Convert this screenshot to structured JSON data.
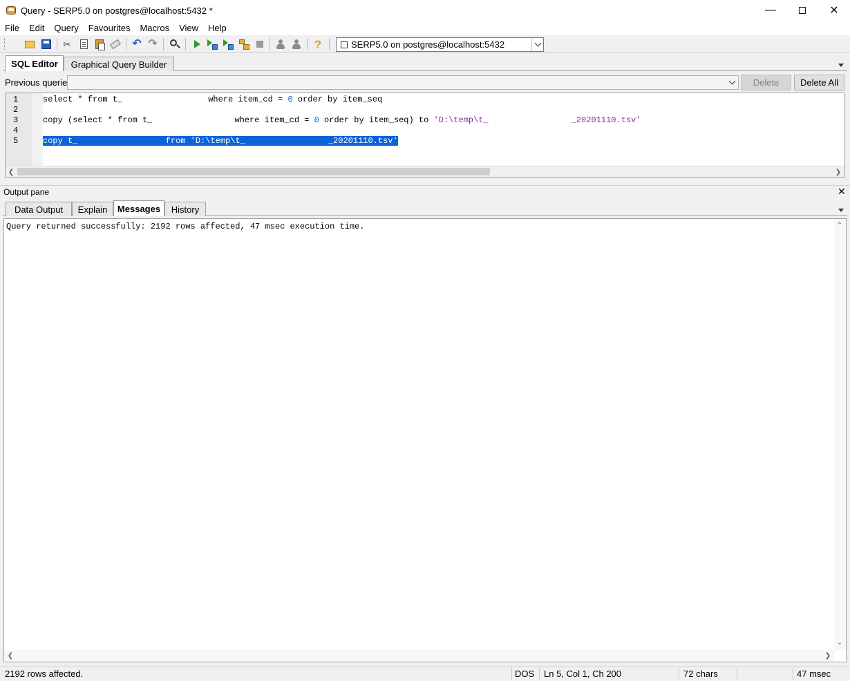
{
  "window": {
    "title": "Query - SERP5.0 on postgres@localhost:5432 *"
  },
  "menu": [
    "File",
    "Edit",
    "Query",
    "Favourites",
    "Macros",
    "View",
    "Help"
  ],
  "toolbar": {
    "icons": [
      "open-folder-icon",
      "save-icon",
      "cut-icon",
      "copy-icon",
      "paste-icon",
      "clear-icon",
      "undo-icon",
      "redo-icon",
      "find-icon",
      "execute-icon",
      "execute-pgscript-icon",
      "execute-to-file-icon",
      "explain-icon",
      "cancel-icon",
      "explain-analyze-icon",
      "vacuum-icon",
      "help-icon"
    ],
    "connection": "SERP5.0 on postgres@localhost:5432"
  },
  "editor_tabs": [
    "SQL Editor",
    "Graphical Query Builder"
  ],
  "previous_queries": {
    "label": "Previous queries",
    "value": "",
    "delete_label": "Delete",
    "delete_all_label": "Delete All"
  },
  "editor": {
    "line_numbers": [
      "1",
      "2",
      "3",
      "4",
      "5"
    ],
    "line1": {
      "a": "select * from t_",
      "b": "where item_cd = ",
      "num": "0",
      "c": " order by item_seq"
    },
    "line3": {
      "a": "copy (select * from t_",
      "b": "where item_cd = ",
      "num": "0",
      "c": " order by item_seq) to ",
      "str_a": "'D:\\temp\\t_",
      "str_b": "_20201110.tsv'"
    },
    "line5": {
      "a": "copy t_",
      "b": " from ",
      "str_a": "'D:\\temp\\t_",
      "str_b": "_20201110.tsv'"
    }
  },
  "output": {
    "pane_title": "Output pane",
    "tabs": [
      "Data Output",
      "Explain",
      "Messages",
      "History"
    ],
    "message": "Query returned successfully: 2192 rows affected, 47 msec execution time."
  },
  "status": {
    "message": "2192 rows affected.",
    "line_endings": "DOS",
    "position": "Ln 5, Col 1, Ch 200",
    "chars": "72 chars",
    "time": "47 msec"
  },
  "colors": {
    "selection": "#0a64d8",
    "number": "#1060c0",
    "string": "#8a2ba0"
  }
}
